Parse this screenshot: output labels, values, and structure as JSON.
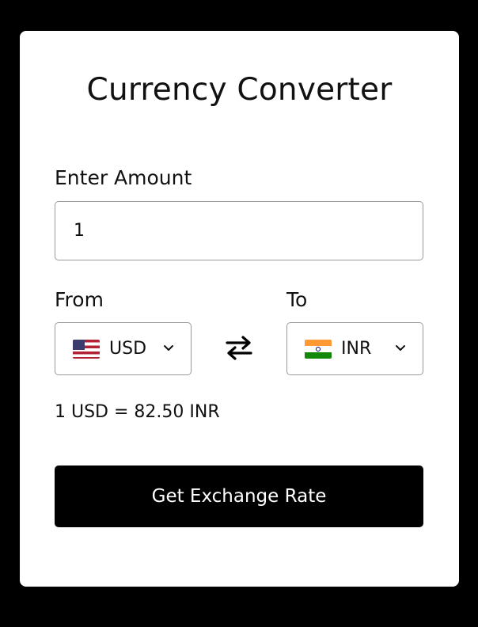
{
  "app": {
    "title": "Currency Converter"
  },
  "amount": {
    "label": "Enter Amount",
    "value": "1"
  },
  "from": {
    "label": "From",
    "currency": "USD",
    "flag": "us-flag-icon"
  },
  "to": {
    "label": "To",
    "currency": "INR",
    "flag": "india-flag-icon"
  },
  "swap": {
    "icon": "swap-arrows-icon"
  },
  "result": {
    "text": "1 USD = 82.50 INR"
  },
  "action": {
    "label": "Get Exchange Rate"
  },
  "colors": {
    "background": "#000000",
    "card": "#ffffff",
    "button": "#000000",
    "button_text": "#ffffff",
    "border": "#9a9a9a"
  }
}
